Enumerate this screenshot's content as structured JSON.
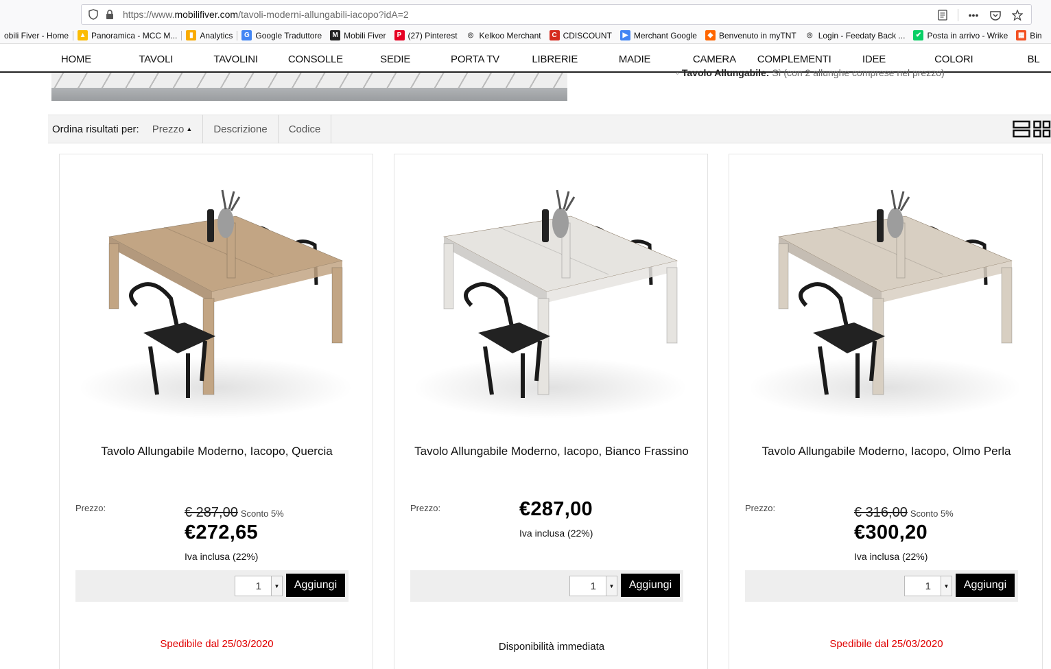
{
  "browser": {
    "url_prefix": "https://www.",
    "url_domain": "mobilifiver.com",
    "url_path": "/tavoli-moderni-allungabili-iacopo?idA=2",
    "bookmarks": [
      {
        "label": "obili Fiver - Home",
        "icon": "site-icon",
        "color": "#ffffff"
      },
      {
        "label": "Panoramica - MCC M...",
        "icon": "google-ads-icon",
        "color": "#fbbc04"
      },
      {
        "label": "Analytics",
        "icon": "analytics-icon",
        "color": "#f9ab00"
      },
      {
        "label": "Google Traduttore",
        "icon": "translate-icon",
        "color": "#4285f4"
      },
      {
        "label": "Mobili Fiver",
        "icon": "mobilifiver-icon",
        "color": "#222222"
      },
      {
        "label": "(27) Pinterest",
        "icon": "pinterest-icon",
        "color": "#e60023"
      },
      {
        "label": "Kelkoo Merchant",
        "icon": "globe-icon",
        "color": "#555555"
      },
      {
        "label": "CDISCOUNT",
        "icon": "cdiscount-icon",
        "color": "#d52b1e"
      },
      {
        "label": "Merchant Google",
        "icon": "merchant-icon",
        "color": "#4285f4"
      },
      {
        "label": "Benvenuto in myTNT",
        "icon": "tnt-icon",
        "color": "#ff6600"
      },
      {
        "label": "Login - Feedaty Back ...",
        "icon": "globe-icon",
        "color": "#555555"
      },
      {
        "label": "Posta in arrivo - Wrike",
        "icon": "wrike-icon",
        "color": "#08cf65"
      },
      {
        "label": "Bin",
        "icon": "microsoft-icon",
        "color": "#f25022"
      }
    ]
  },
  "nav": [
    "HOME",
    "TAVOLI",
    "TAVOLINI",
    "CONSOLLE",
    "SEDIE",
    "PORTA TV",
    "LIBRERIE",
    "MADIE",
    "CAMERA",
    "COMPLEMENTI",
    "IDEE",
    "COLORI",
    "BL"
  ],
  "description": {
    "label": "Tavolo Allungabile:",
    "text": "Sì (con 2 allunghe comprese nel prezzo)"
  },
  "sort": {
    "label": "Ordina risultati per:",
    "options": [
      "Prezzo",
      "Descrizione",
      "Codice"
    ]
  },
  "products": [
    {
      "title": "Tavolo Allungabile Moderno, Iacopo, Quercia",
      "price_label": "Prezzo:",
      "old_price": "€ 287,00",
      "discount": "Sconto 5%",
      "price": "€272,65",
      "vat": "Iva inclusa (22%)",
      "qty": "1",
      "add_label": "Aggiungi",
      "availability": "Spedibile dal 25/03/2020",
      "wood_color": "#c2a584"
    },
    {
      "title": "Tavolo Allungabile Moderno, Iacopo, Bianco Frassino",
      "price_label": "Prezzo:",
      "old_price": "",
      "discount": "",
      "price": "€287,00",
      "vat": "Iva inclusa (22%)",
      "qty": "1",
      "add_label": "Aggiungi",
      "availability": "Disponibilità immediata",
      "wood_color": "#e6e4e0"
    },
    {
      "title": "Tavolo Allungabile Moderno, Iacopo, Olmo Perla",
      "price_label": "Prezzo:",
      "old_price": "€ 316,00",
      "discount": "Sconto 5%",
      "price": "€300,20",
      "vat": "Iva inclusa (22%)",
      "qty": "1",
      "add_label": "Aggiungi",
      "availability": "Spedibile dal 25/03/2020",
      "wood_color": "#d8cfc2"
    }
  ]
}
